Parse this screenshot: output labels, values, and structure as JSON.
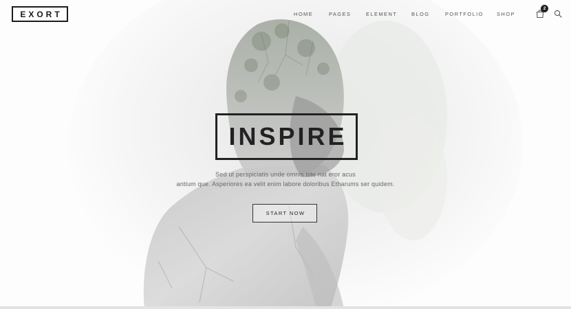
{
  "header": {
    "logo": "EXORT",
    "nav": [
      "HOME",
      "PAGES",
      "ELEMENT",
      "BLOG",
      "PORTFOLIO",
      "SHOP"
    ],
    "cart_count": "2",
    "cart_icon": "shopping-bag-icon",
    "search_icon": "search-icon"
  },
  "hero": {
    "title": "INSPIRE",
    "subtitle_line1": "Sed ut perspiciatis unde omnis iste nat eror acus",
    "subtitle_line2": "antium que. Asperiores ea velit enim labore doloribus Etharums ser quidem.",
    "cta_label": "START NOW"
  },
  "colors": {
    "text_dark": "#222222",
    "text_muted": "#666666",
    "background": "#fdfdfd"
  }
}
